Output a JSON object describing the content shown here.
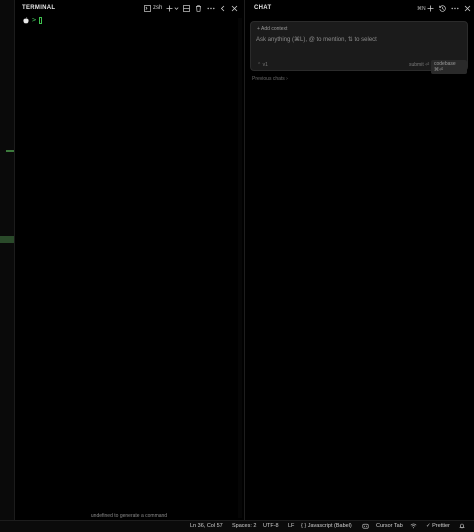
{
  "terminal": {
    "title": "TERMINAL",
    "shell_label": "zsh",
    "prompt_arrow": ">",
    "hint": "undefined to generate a command"
  },
  "chat": {
    "title": "CHAT",
    "zoom_label": "⌘N",
    "add_context": "+ Add context",
    "input_placeholder": "Ask anything (⌘L), @ to mention, ⇅ to select",
    "model_label": "⌃ v1",
    "submit_label": "submit ⏎",
    "codebase_label": "codebase ⌘⏎",
    "previous_chats": "Previous chats ›"
  },
  "statusbar": {
    "position": "Ln 36, Col 57",
    "spaces": "Spaces: 2",
    "encoding": "UTF-8",
    "eol": "LF",
    "language": "{ } Javascript (Babel)",
    "cursor_tab": "Cursor Tab",
    "prettier": "✓ Prettier"
  },
  "colors": {
    "accent_green": "#3fc24f",
    "background": "#000000"
  }
}
